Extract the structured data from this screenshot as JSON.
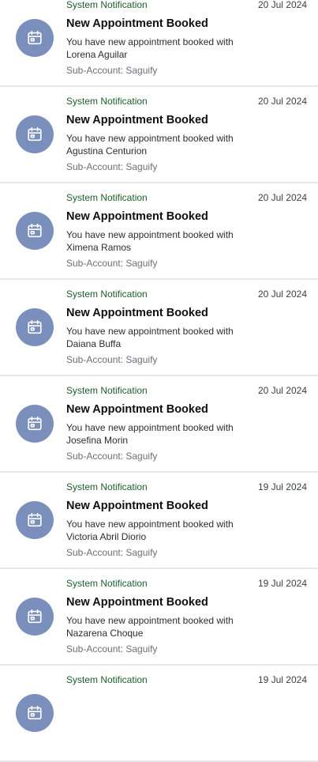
{
  "notifications": [
    {
      "category": "System Notification",
      "date": "20 Jul 2024",
      "title": "New Appointment Booked",
      "message": "You have new appointment booked with",
      "person": "Lorena Aguilar",
      "subaccount": "Sub-Account: Saguify",
      "icon": "calendar-icon"
    },
    {
      "category": "System Notification",
      "date": "20 Jul 2024",
      "title": "New Appointment Booked",
      "message": "You have new appointment booked with",
      "person": "Agustina Centurion",
      "subaccount": "Sub-Account: Saguify",
      "icon": "calendar-icon"
    },
    {
      "category": "System Notification",
      "date": "20 Jul 2024",
      "title": "New Appointment Booked",
      "message": "You have new appointment booked with",
      "person": "Ximena Ramos",
      "subaccount": "Sub-Account: Saguify",
      "icon": "calendar-icon"
    },
    {
      "category": "System Notification",
      "date": "20 Jul 2024",
      "title": "New Appointment Booked",
      "message": "You have new appointment booked with",
      "person": "Daiana Buffa",
      "subaccount": "Sub-Account: Saguify",
      "icon": "calendar-icon"
    },
    {
      "category": "System Notification",
      "date": "20 Jul 2024",
      "title": "New Appointment Booked",
      "message": "You have new appointment booked with",
      "person": "Josefina Morin",
      "subaccount": "Sub-Account: Saguify",
      "icon": "calendar-icon"
    },
    {
      "category": "System Notification",
      "date": "19 Jul 2024",
      "title": "New Appointment Booked",
      "message": "You have new appointment booked with",
      "person": "Victoria Abril Diorio",
      "subaccount": "Sub-Account: Saguify",
      "icon": "calendar-icon"
    },
    {
      "category": "System Notification",
      "date": "19 Jul 2024",
      "title": "New Appointment Booked",
      "message": "You have new appointment booked with",
      "person": "Nazarena Choque",
      "subaccount": "Sub-Account: Saguify",
      "icon": "calendar-icon"
    },
    {
      "category": "System Notification",
      "date": "19 Jul 2024",
      "title": "",
      "message": "",
      "person": "",
      "subaccount": "",
      "icon": "calendar-icon"
    }
  ],
  "colors": {
    "category": "#1d5e2a",
    "avatar": "#7b8fbd",
    "divider": "#e6e8eb"
  }
}
